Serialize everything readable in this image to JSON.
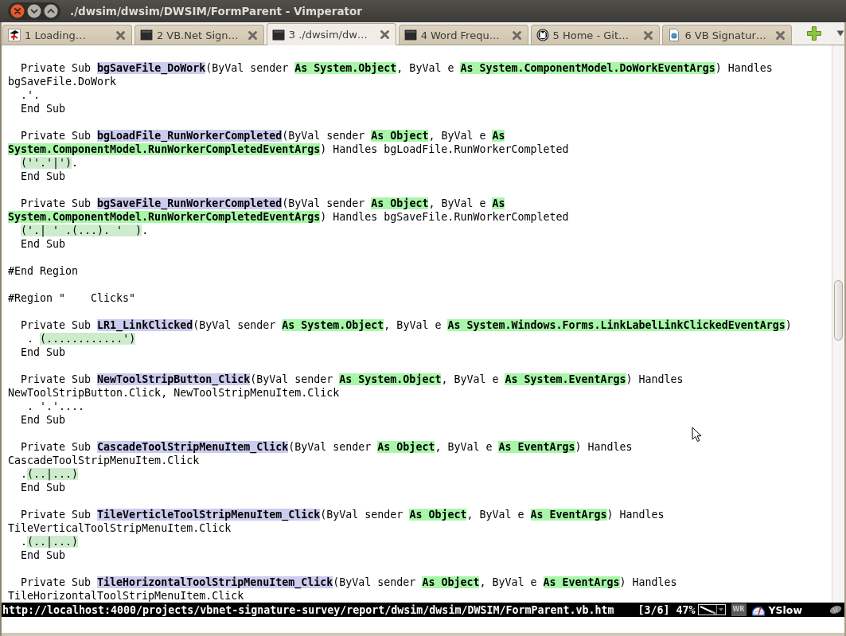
{
  "window": {
    "title": "./dwsim/dwsim/DWSIM/FormParent - Vimperator"
  },
  "tabs": [
    {
      "number": "1",
      "label": "Loading…",
      "kind": "figure",
      "selected": false
    },
    {
      "number": "2",
      "label": "VB.Net Sign…",
      "kind": "square",
      "selected": false
    },
    {
      "number": "3",
      "label": "./dwsim/dw…",
      "kind": "square",
      "selected": true
    },
    {
      "number": "4",
      "label": "Word Frequ…",
      "kind": "square",
      "selected": false
    },
    {
      "number": "5",
      "label": "Home - Git…",
      "kind": "cat",
      "selected": false
    },
    {
      "number": "6",
      "label": "VB Signatur…",
      "kind": "document",
      "selected": false
    }
  ],
  "code": {
    "blocks": [
      {
        "lines": [
          [
            {
              "kind": "plain",
              "text": "  Private Sub "
            },
            {
              "kind": "name",
              "text": "bgSaveFile_DoWork"
            },
            {
              "kind": "plain",
              "text": "(ByVal sender "
            },
            {
              "kind": "type",
              "text": "As System.Object"
            },
            {
              "kind": "plain",
              "text": ", ByVal e "
            },
            {
              "kind": "type",
              "text": "As System.ComponentModel.DoWorkEventArgs"
            },
            {
              "kind": "plain",
              "text": ") Handles"
            }
          ],
          [
            {
              "kind": "plain",
              "text": "bgSaveFile.DoWork"
            }
          ],
          [
            {
              "kind": "plain",
              "text": "  .'."
            }
          ],
          [
            {
              "kind": "plain",
              "text": "  End Sub"
            }
          ]
        ]
      },
      {
        "lines": [
          [
            {
              "kind": "plain",
              "text": "  Private Sub "
            },
            {
              "kind": "name",
              "text": "bgLoadFile_RunWorkerCompleted"
            },
            {
              "kind": "plain",
              "text": "(ByVal sender "
            },
            {
              "kind": "type",
              "text": "As Object"
            },
            {
              "kind": "plain",
              "text": ", ByVal e "
            },
            {
              "kind": "type",
              "text": "As"
            }
          ],
          [
            {
              "kind": "type",
              "text": "System.ComponentModel.RunWorkerCompletedEventArgs"
            },
            {
              "kind": "plain",
              "text": ") Handles bgLoadFile.RunWorkerCompleted"
            }
          ],
          [
            {
              "kind": "literal",
              "text": "  (''.'|')"
            },
            {
              "kind": "plain",
              "text": "."
            }
          ],
          [
            {
              "kind": "plain",
              "text": "  End Sub"
            }
          ]
        ]
      },
      {
        "lines": [
          [
            {
              "kind": "plain",
              "text": "  Private Sub "
            },
            {
              "kind": "name",
              "text": "bgSaveFile_RunWorkerCompleted"
            },
            {
              "kind": "plain",
              "text": "(ByVal sender "
            },
            {
              "kind": "type",
              "text": "As Object"
            },
            {
              "kind": "plain",
              "text": ", ByVal e "
            },
            {
              "kind": "type",
              "text": "As"
            }
          ],
          [
            {
              "kind": "type",
              "text": "System.ComponentModel.RunWorkerCompletedEventArgs"
            },
            {
              "kind": "plain",
              "text": ") Handles bgSaveFile.RunWorkerCompleted"
            }
          ],
          [
            {
              "kind": "literal",
              "text": "  ('.| ' .(...). '  )"
            },
            {
              "kind": "plain",
              "text": "."
            }
          ],
          [
            {
              "kind": "plain",
              "text": "  End Sub"
            }
          ]
        ]
      },
      {
        "lines": [
          [
            {
              "kind": "plain",
              "text": "#End Region"
            }
          ]
        ]
      },
      {
        "lines": [
          [
            {
              "kind": "plain",
              "text": "#Region \"    Clicks\""
            }
          ]
        ]
      },
      {
        "lines": [
          [
            {
              "kind": "plain",
              "text": "  Private Sub "
            },
            {
              "kind": "name",
              "text": "LR1_LinkClicked"
            },
            {
              "kind": "plain",
              "text": "(ByVal sender "
            },
            {
              "kind": "type",
              "text": "As System.Object"
            },
            {
              "kind": "plain",
              "text": ", ByVal e "
            },
            {
              "kind": "type",
              "text": "As System.Windows.Forms.LinkLabelLinkClickedEventArgs"
            },
            {
              "kind": "plain",
              "text": ")"
            }
          ],
          [
            {
              "kind": "plain",
              "text": "   ."
            },
            {
              "kind": "literal",
              "text": " (............')"
            }
          ],
          [
            {
              "kind": "plain",
              "text": "  End Sub"
            }
          ]
        ]
      },
      {
        "lines": [
          [
            {
              "kind": "plain",
              "text": "  Private Sub "
            },
            {
              "kind": "name",
              "text": "NewToolStripButton_Click"
            },
            {
              "kind": "plain",
              "text": "(ByVal sender "
            },
            {
              "kind": "type",
              "text": "As System.Object"
            },
            {
              "kind": "plain",
              "text": ", ByVal e "
            },
            {
              "kind": "type",
              "text": "As System.EventArgs"
            },
            {
              "kind": "plain",
              "text": ") Handles"
            }
          ],
          [
            {
              "kind": "plain",
              "text": "NewToolStripButton.Click, NewToolStripMenuItem.Click"
            }
          ],
          [
            {
              "kind": "plain",
              "text": "   . '.'...."
            }
          ],
          [
            {
              "kind": "plain",
              "text": "  End Sub"
            }
          ]
        ]
      },
      {
        "lines": [
          [
            {
              "kind": "plain",
              "text": "  Private Sub "
            },
            {
              "kind": "name",
              "text": "CascadeToolStripMenuItem_Click"
            },
            {
              "kind": "plain",
              "text": "(ByVal sender "
            },
            {
              "kind": "type",
              "text": "As Object"
            },
            {
              "kind": "plain",
              "text": ", ByVal e "
            },
            {
              "kind": "type",
              "text": "As EventArgs"
            },
            {
              "kind": "plain",
              "text": ") Handles"
            }
          ],
          [
            {
              "kind": "plain",
              "text": "CascadeToolStripMenuItem.Click"
            }
          ],
          [
            {
              "kind": "plain",
              "text": "  ."
            },
            {
              "kind": "literal",
              "text": "(..|...)"
            }
          ],
          [
            {
              "kind": "plain",
              "text": "  End Sub"
            }
          ]
        ]
      },
      {
        "lines": [
          [
            {
              "kind": "plain",
              "text": "  Private Sub "
            },
            {
              "kind": "name",
              "text": "TileVerticleToolStripMenuItem_Click"
            },
            {
              "kind": "plain",
              "text": "(ByVal sender "
            },
            {
              "kind": "type",
              "text": "As Object"
            },
            {
              "kind": "plain",
              "text": ", ByVal e "
            },
            {
              "kind": "type",
              "text": "As EventArgs"
            },
            {
              "kind": "plain",
              "text": ") Handles"
            }
          ],
          [
            {
              "kind": "plain",
              "text": "TileVerticalToolStripMenuItem.Click"
            }
          ],
          [
            {
              "kind": "plain",
              "text": "  ."
            },
            {
              "kind": "literal",
              "text": "(..|...)"
            }
          ],
          [
            {
              "kind": "plain",
              "text": "  End Sub"
            }
          ]
        ]
      },
      {
        "lines": [
          [
            {
              "kind": "plain",
              "text": "  Private Sub "
            },
            {
              "kind": "name",
              "text": "TileHorizontalToolStripMenuItem_Click"
            },
            {
              "kind": "plain",
              "text": "(ByVal sender "
            },
            {
              "kind": "type",
              "text": "As Object"
            },
            {
              "kind": "plain",
              "text": ", ByVal e "
            },
            {
              "kind": "type",
              "text": "As EventArgs"
            },
            {
              "kind": "plain",
              "text": ") Handles"
            }
          ],
          [
            {
              "kind": "plain",
              "text": "TileHorizontalToolStripMenuItem.Click"
            }
          ]
        ]
      }
    ]
  },
  "status_bar": {
    "url": "http://localhost:4000/projects/vbnet-signature-survey/report/dwsim/dwsim/DWSIM/FormParent.vb.htm",
    "tab_position": "[3/6]",
    "scroll_percent": "47%",
    "wr_button": "WR",
    "yslow": "YSlow"
  }
}
